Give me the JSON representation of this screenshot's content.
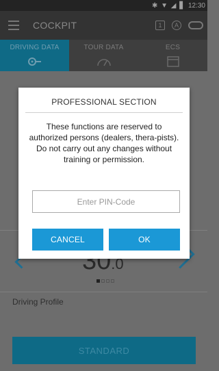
{
  "status_bar": {
    "time": "12:30",
    "icons": "✱ ▼ ◢ ▋"
  },
  "app_bar": {
    "title": "COCKPIT",
    "icon_1_label": "1",
    "icon_2_label": "A"
  },
  "tabs": [
    {
      "label": "DRIVING DATA",
      "icon": "driving-data-icon",
      "active": true
    },
    {
      "label": "TOUR DATA",
      "icon": "speedometer-icon",
      "active": false
    },
    {
      "label": "ECS",
      "icon": "ecs-icon",
      "active": false
    }
  ],
  "main": {
    "value_display": {
      "integer": "30",
      "decimal": ".0"
    },
    "pager": {
      "total": 4,
      "current": 1
    },
    "driving_profile_label": "Driving Profile",
    "profile_button_label": "STANDARD"
  },
  "dialog": {
    "title": "PROFESSIONAL SECTION",
    "message": "These functions are reserved to authorized persons (dealers, thera-pists). Do not carry out any changes without training or permission.",
    "pin_placeholder": "Enter PIN-Code",
    "cancel_label": "CANCEL",
    "ok_label": "OK"
  },
  "colors": {
    "accent": "#1b98d6",
    "dim_accent": "#0f6a86",
    "appbar": "#333333"
  }
}
